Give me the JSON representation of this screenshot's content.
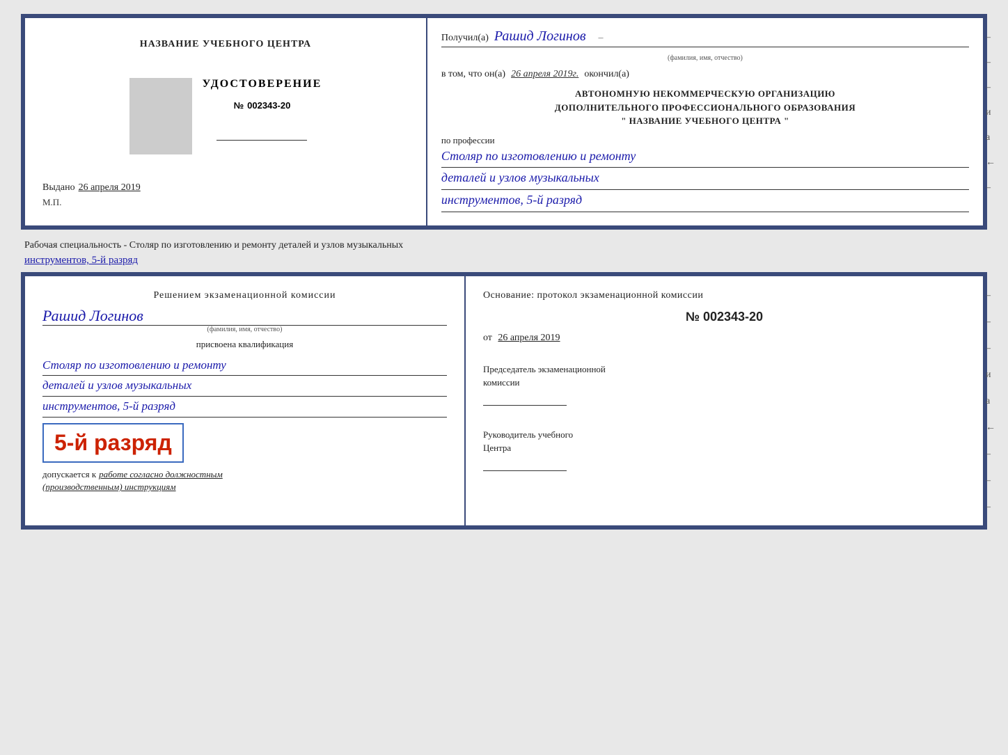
{
  "top_cert": {
    "left": {
      "org_name": "НАЗВАНИЕ УЧЕБНОГО ЦЕНТРА",
      "udostoverenie_label": "УДОСТОВЕРЕНИЕ",
      "number_prefix": "№",
      "number": "002343-20",
      "issued_label": "Выдано",
      "issued_date": "26 апреля 2019",
      "mp_label": "М.П."
    },
    "right": {
      "poluchil_label": "Получил(а)",
      "recipient_name": "Рашид Логинов",
      "fio_label": "(фамилия, имя, отчество)",
      "vtom_label": "в том, что он(а)",
      "vtom_date": "26 апреля 2019г.",
      "okonchil_label": "окончил(а)",
      "org_desc_line1": "АВТОНОМНУЮ НЕКОММЕРЧЕСКУЮ ОРГАНИЗАЦИЮ",
      "org_desc_line2": "ДОПОЛНИТЕЛЬНОГО ПРОФЕССИОНАЛЬНОГО ОБРАЗОВАНИЯ",
      "org_desc_line3": "\"   НАЗВАНИЕ УЧЕБНОГО ЦЕНТРА   \"",
      "profession_label": "по профессии",
      "profession_line1": "Столяр по изготовлению и ремонту",
      "profession_line2": "деталей и узлов музыкальных",
      "profession_line3": "инструментов, 5-й разряд"
    },
    "edge_marks": [
      "-",
      "-",
      "-",
      "и",
      "а",
      "←",
      "-"
    ]
  },
  "middle": {
    "text_start": "Рабочая специальность - Столяр по изготовлению и ремонту деталей и узлов музыкальных",
    "text_underline": "инструментов, 5-й разряд"
  },
  "bottom_cert": {
    "left": {
      "resolution_text": "Решением экзаменационной комиссии",
      "person_name": "Рашид Логинов",
      "fio_label": "(фамилия, имя, отчество)",
      "prisvoena_label": "присвоена квалификация",
      "qualification_line1": "Столяр по изготовлению и ремонту",
      "qualification_line2": "деталей и узлов музыкальных",
      "qualification_line3": "инструментов, 5-й разряд",
      "razryad_big": "5-й разряд",
      "dopuskaetsya_label": "допускается к",
      "dopuskaetsya_text": "работе согласно должностным",
      "dopuskaetsya_text2": "(производственным) инструкциям"
    },
    "right": {
      "osnovanie_label": "Основание: протокол экзаменационной комиссии",
      "number_prefix": "№",
      "number": "002343-20",
      "ot_label": "от",
      "ot_date": "26 апреля 2019",
      "chairman_label": "Председатель экзаменационной",
      "chairman_label2": "комиссии",
      "director_label": "Руководитель учебного",
      "director_label2": "Центра"
    },
    "edge_marks": [
      "-",
      "-",
      "-",
      "и",
      "а",
      "←",
      "-",
      "-",
      "-"
    ]
  }
}
